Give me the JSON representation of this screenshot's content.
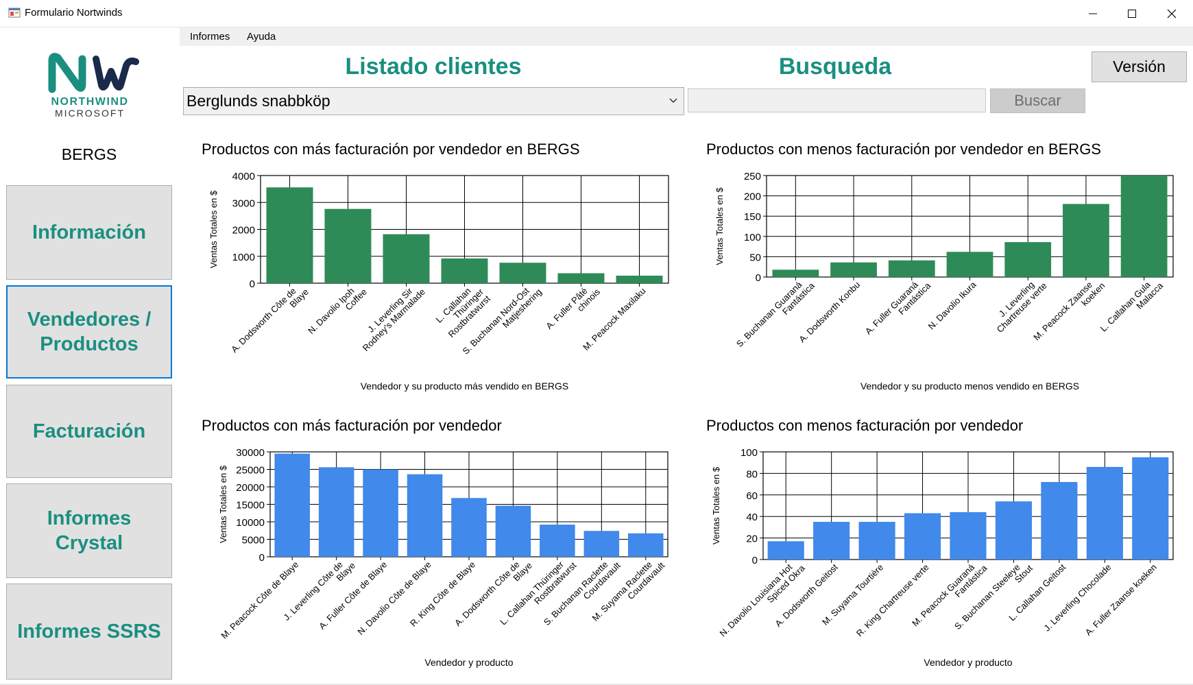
{
  "window": {
    "title": "Formulario Nortwinds",
    "minimize_icon": "minimize-icon",
    "maximize_icon": "maximize-icon",
    "close_icon": "close-icon"
  },
  "menu": {
    "items": [
      "Informes",
      "Ayuda"
    ]
  },
  "logo": {
    "name": "NORTHWIND",
    "sub": "MICROSOFT",
    "color": "#1a8f80"
  },
  "sidebar": {
    "client_code": "BERGS",
    "buttons": [
      {
        "label": "Información",
        "active": false
      },
      {
        "label": "Vendedores / Productos",
        "active": true
      },
      {
        "label": "Facturación",
        "active": false
      },
      {
        "label": "Informes Crystal",
        "active": false
      },
      {
        "label": "Informes SSRS",
        "active": false
      }
    ]
  },
  "header": {
    "clients_title": "Listado clientes",
    "search_title": "Busqueda",
    "version_label": "Versión",
    "client_selected": "Berglunds snabbköp",
    "search_value": "",
    "search_button": "Buscar"
  },
  "colors": {
    "accent": "#1a8f80",
    "green_bar": "#2e8b57",
    "blue_bar": "#4189ea"
  },
  "chart_data": [
    {
      "type": "bar",
      "title": "Productos con más facturación por vendedor en BERGS",
      "xlabel": "Vendedor y su producto más vendido en BERGS",
      "ylabel": "Ventas Totales en $",
      "ylim": [
        0,
        4000
      ],
      "yticks": [
        0,
        1000,
        2000,
        3000,
        4000
      ],
      "color": "#2e8b57",
      "categories": [
        "A. Dodsworth Côte de Blaye",
        "N. Davolio Ipoh Coffee",
        "J. Leverling Sir Rodney's Marmalade",
        "L. Callahan Thüringer Rostbratwurst",
        "S. Buchanan Nord-Ost Matjeshering",
        "A. Fuller Pâté chinois",
        "M. Peacock Maxilaku"
      ],
      "values": [
        3560,
        2760,
        1820,
        920,
        760,
        370,
        280
      ]
    },
    {
      "type": "bar",
      "title": "Productos con menos facturación por vendedor en BERGS",
      "xlabel": "Vendedor y su producto menos vendido en BERGS",
      "ylabel": "Ventas Totales en $",
      "ylim": [
        0,
        250
      ],
      "yticks": [
        0,
        50,
        100,
        150,
        200,
        250
      ],
      "color": "#2e8b57",
      "categories": [
        "S. Buchanan Guaraná Fantástica",
        "A. Dodsworth Konbu",
        "A. Fuller Guaraná Fantástica",
        "N. Davolio Ikura",
        "J. Leverling Chartreuse verte",
        "M. Peacock Zaanse koeken",
        "L. Callahan Gula Malacca"
      ],
      "values": [
        18,
        36,
        41,
        62,
        86,
        180,
        250
      ]
    },
    {
      "type": "bar",
      "title": "Productos con más facturación por vendedor",
      "xlabel": "Vendedor y producto",
      "ylabel": "Ventas Totales en $",
      "ylim": [
        0,
        30000
      ],
      "yticks": [
        0,
        5000,
        10000,
        15000,
        20000,
        25000,
        30000
      ],
      "color": "#4189ea",
      "categories": [
        "M. Peacock Côte de Blaye",
        "J. Leverling Côte de Blaye",
        "A. Fuller Côte de Blaye",
        "N. Davolio Côte de Blaye",
        "R. King Côte de Blaye",
        "A. Dodsworth Côte de Blaye",
        "L. Callahan Thüringer Rostbratwurst",
        "S. Buchanan Raclette Courdavault",
        "M. Suyama Raclette Courdavault"
      ],
      "values": [
        29500,
        25600,
        25000,
        23600,
        16800,
        14600,
        9200,
        7400,
        6700
      ]
    },
    {
      "type": "bar",
      "title": "Productos con menos facturación por vendedor",
      "xlabel": "Vendedor y producto",
      "ylabel": "Ventas Totales en $",
      "ylim": [
        0,
        100
      ],
      "yticks": [
        0,
        20,
        40,
        60,
        80,
        100
      ],
      "color": "#4189ea",
      "categories": [
        "N. Davolio Louisiana Hot Spiced Okra",
        "A. Dodsworth Geitost",
        "M. Suyama Tourtière",
        "R. King Chartreuse verte",
        "M. Peacock Guaraná Fantástica",
        "S. Buchanan Steeleye Stout",
        "L. Callahan Geitost",
        "J. Leverling Chocolade",
        "A. Fuller Zaanse koeken"
      ],
      "values": [
        17,
        35,
        35,
        43,
        44,
        54,
        72,
        86,
        95
      ]
    }
  ]
}
